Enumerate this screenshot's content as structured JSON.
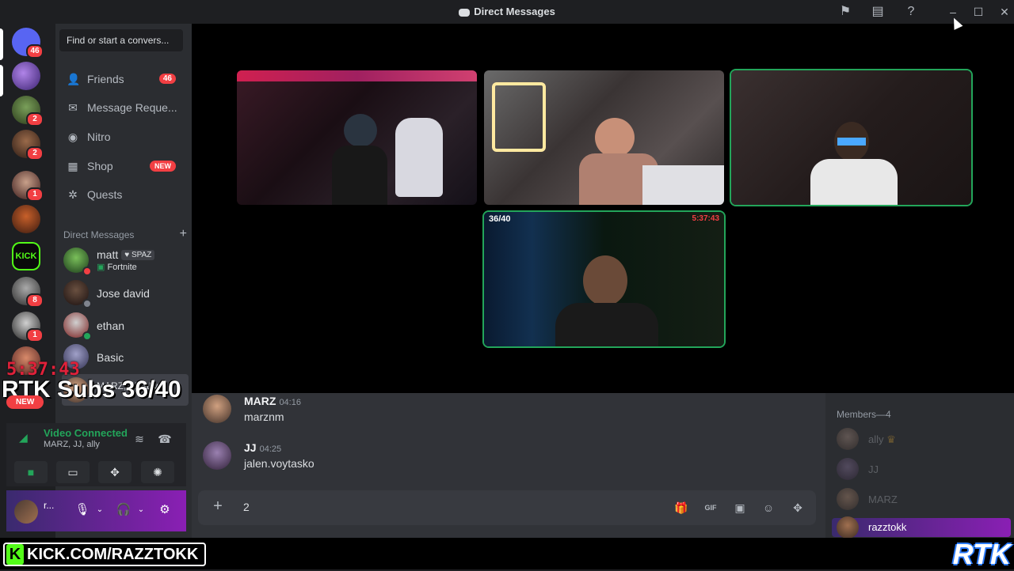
{
  "window": {
    "title": "Direct Messages"
  },
  "servers": [
    {
      "name": "home",
      "badge": "46"
    },
    {
      "name": "server-1",
      "badge": ""
    },
    {
      "name": "server-2",
      "badge": "2"
    },
    {
      "name": "server-3",
      "badge": "2"
    },
    {
      "name": "server-4",
      "badge": "1"
    },
    {
      "name": "server-5",
      "badge": ""
    },
    {
      "name": "kick-server",
      "badge": "",
      "label": "KICK"
    },
    {
      "name": "server-7",
      "badge": "8"
    },
    {
      "name": "server-8",
      "badge": "1"
    },
    {
      "name": "server-9",
      "badge": ""
    }
  ],
  "search": {
    "placeholder": "Find or start a convers..."
  },
  "nav": {
    "friends": "Friends",
    "friends_badge": "46",
    "requests": "Message Reque...",
    "nitro": "Nitro",
    "shop": "Shop",
    "shop_badge": "NEW",
    "quests": "Quests"
  },
  "dm_header": "Direct Messages",
  "dms": [
    {
      "name": "matt",
      "tag": "SPAZ",
      "sub": "Fortnite",
      "status": "dnd"
    },
    {
      "name": "Jose david",
      "tag": "",
      "sub": "",
      "status": "offline"
    },
    {
      "name": "ethan",
      "tag": "",
      "sub": "",
      "status": "online"
    },
    {
      "name": "Basic",
      "tag": "",
      "sub": "",
      "status": "none"
    },
    {
      "name": "MARZ, JJ, ally",
      "tag": "",
      "sub": "",
      "status": "none"
    }
  ],
  "voice": {
    "title": "Video Connected",
    "sub": "MARZ, JJ, ally"
  },
  "user": {
    "name": "r..."
  },
  "tiles": [
    {
      "name": "tile-1",
      "label": "",
      "stamp": ""
    },
    {
      "name": "tile-2",
      "label": "",
      "stamp": ""
    },
    {
      "name": "tile-3",
      "label": "",
      "stamp": ""
    },
    {
      "name": "tile-4",
      "label": "36/40",
      "stamp": "5:37:43"
    }
  ],
  "messages": [
    {
      "author": "MARZ",
      "time": "04:16",
      "text": "marznm"
    },
    {
      "author": "JJ",
      "time": "04:25",
      "text": "jalen.voytasko"
    }
  ],
  "composer": {
    "text": "2"
  },
  "members_header": "Members—4",
  "members": [
    {
      "name": "ally"
    },
    {
      "name": "JJ"
    },
    {
      "name": "MARZ"
    },
    {
      "name": "razztokk"
    }
  ],
  "overlay": {
    "timer": "5:37:43",
    "subs": "RTK Subs 36/40",
    "new": "NEW",
    "kick": "KICK.COM/RAZZTOKK",
    "kick_k": "K",
    "brand": "RTK"
  }
}
